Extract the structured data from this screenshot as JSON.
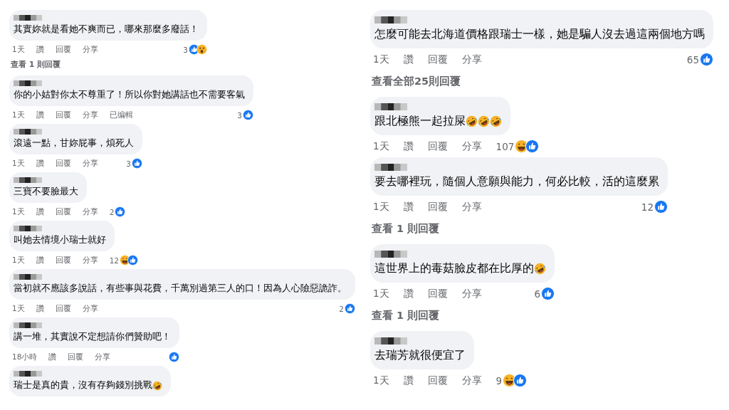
{
  "columns": [
    {
      "kind": "small",
      "items": [
        {
          "kind": "comment",
          "text": "其實妳就是看她不爽而已，哪來那麼多廢話！",
          "actions": {
            "time": "1天",
            "like": "讚",
            "reply": "回覆",
            "share": "分享"
          },
          "reactions": {
            "count": "3",
            "icons": [
              {
                "kind": "like"
              },
              {
                "kind": "wow"
              }
            ]
          }
        },
        {
          "kind": "replies",
          "text": "查看 1 則回覆"
        },
        {
          "kind": "comment",
          "text": "你的小姑對你太不尊重了！所以你對她講話也不需要客氣",
          "actions": {
            "time": "1天",
            "like": "讚",
            "reply": "回覆",
            "share": "分享",
            "edited": "已编輯"
          },
          "reactions": {
            "count": "3",
            "icons": [
              {
                "kind": "like"
              }
            ]
          }
        },
        {
          "kind": "comment",
          "text": "滾遠一點，甘妳屁事，煩死人",
          "actions": {
            "time": "1天",
            "like": "讚",
            "reply": "回覆",
            "share": "分享"
          },
          "reactions": {
            "count": "3",
            "icons": [
              {
                "kind": "like"
              }
            ]
          }
        },
        {
          "kind": "comment",
          "text": "三寶不要臉最大",
          "actions": {
            "time": "1天",
            "like": "讚",
            "reply": "回覆",
            "share": "分享"
          },
          "reactions": {
            "count": "2",
            "icons": [
              {
                "kind": "like"
              }
            ]
          }
        },
        {
          "kind": "comment",
          "text": "叫她去情境小瑞士就好",
          "actions": {
            "time": "1天",
            "like": "讚",
            "reply": "回覆",
            "share": "分享"
          },
          "reactions": {
            "count": "12",
            "icons": [
              {
                "kind": "haha"
              },
              {
                "kind": "like"
              }
            ]
          }
        },
        {
          "kind": "comment",
          "text": "當初就不應該多說話，有些事與花費，千萬別過第三人的口！因為人心險惡詭詐。",
          "actions": {
            "time": "1天",
            "like": "讚",
            "reply": "回覆",
            "share": "分享"
          },
          "reactions": {
            "count": "2",
            "icons": [
              {
                "kind": "like"
              }
            ]
          }
        },
        {
          "kind": "comment",
          "text": "講一堆，其實說不定想請你們贊助吧！",
          "actions": {
            "time": "18小時",
            "like": "讚",
            "reply": "回覆",
            "share": "分享"
          },
          "reactions": {
            "icons": [
              {
                "kind": "like"
              }
            ]
          }
        },
        {
          "kind": "comment",
          "text": "瑞士是真的貴，沒有存夠錢別挑戰",
          "emojis": [
            {
              "kind": "rofl"
            }
          ]
        }
      ]
    },
    {
      "kind": "large",
      "items": [
        {
          "kind": "comment",
          "text": "怎麼可能去北海道價格跟瑞士一樣，她是騙人沒去過這兩個地方嗎",
          "actions": {
            "time": "1天",
            "like": "讚",
            "reply": "回覆",
            "share": "分享"
          },
          "reactions": {
            "count": "65",
            "icons": [
              {
                "kind": "like"
              }
            ]
          }
        },
        {
          "kind": "replies",
          "text": "查看全部25則回覆"
        },
        {
          "kind": "comment",
          "text": "跟北極熊一起拉屎",
          "emojis": [
            {
              "kind": "rofl"
            },
            {
              "kind": "rofl"
            },
            {
              "kind": "rofl"
            }
          ],
          "actions": {
            "time": "1天",
            "like": "讚",
            "reply": "回覆",
            "share": "分享"
          },
          "reactions": {
            "count": "107",
            "icons": [
              {
                "kind": "haha"
              },
              {
                "kind": "like"
              }
            ]
          }
        },
        {
          "kind": "comment",
          "text": "要去哪裡玩，隨個人意願與能力，何必比較，活的這麼累",
          "actions": {
            "time": "1天",
            "like": "讚",
            "reply": "回覆",
            "share": "分享"
          },
          "reactions": {
            "count": "12",
            "icons": [
              {
                "kind": "like"
              }
            ]
          }
        },
        {
          "kind": "replies",
          "text": "查看 1 則回覆"
        },
        {
          "kind": "comment",
          "text": "這世界上的毒菇臉皮都在比厚的",
          "emojis": [
            {
              "kind": "rofl"
            }
          ],
          "actions": {
            "time": "1天",
            "like": "讚",
            "reply": "回覆",
            "share": "分享"
          },
          "reactions": {
            "count": "6",
            "icons": [
              {
                "kind": "like"
              }
            ]
          }
        },
        {
          "kind": "replies",
          "text": "查看 1 則回覆"
        },
        {
          "kind": "comment",
          "text": "去瑞芳就很便宜了",
          "actions": {
            "time": "1天",
            "like": "讚",
            "reply": "回覆",
            "share": "分享"
          },
          "reactions": {
            "count": "9",
            "icons": [
              {
                "kind": "haha"
              },
              {
                "kind": "like"
              }
            ]
          }
        }
      ]
    }
  ]
}
